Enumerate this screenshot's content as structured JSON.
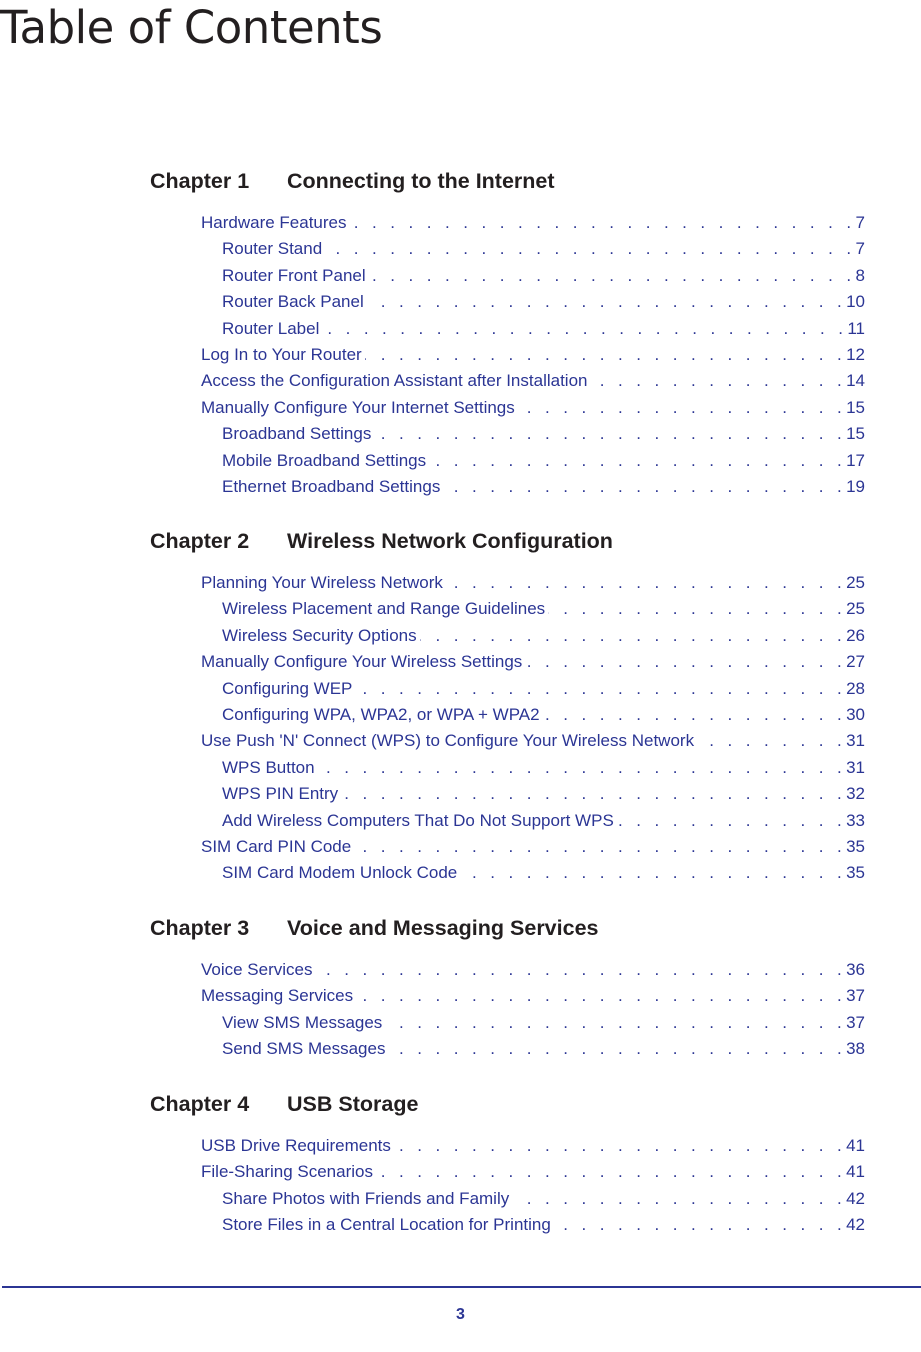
{
  "page": {
    "title": "Table of Contents",
    "footer_page_number": "3",
    "colors": {
      "heading": "#231f20",
      "entry_text": "#2b3594",
      "footer_rule": "#2b3594"
    }
  },
  "chapters": [
    {
      "label": "Chapter 1",
      "title": "Connecting to the Internet",
      "entries": [
        {
          "level": 1,
          "title": "Hardware Features",
          "page": "7"
        },
        {
          "level": 2,
          "title": "Router Stand",
          "page": "7"
        },
        {
          "level": 2,
          "title": "Router Front Panel",
          "page": "8"
        },
        {
          "level": 2,
          "title": "Router Back Panel",
          "page": "10"
        },
        {
          "level": 2,
          "title": "Router Label",
          "page": "11"
        },
        {
          "level": 1,
          "title": "Log In to Your Router",
          "page": "12"
        },
        {
          "level": 1,
          "title": "Access the Configuration Assistant after Installation",
          "page": "14"
        },
        {
          "level": 1,
          "title": "Manually Configure Your Internet Settings",
          "page": "15"
        },
        {
          "level": 2,
          "title": "Broadband Settings",
          "page": "15"
        },
        {
          "level": 2,
          "title": "Mobile Broadband Settings",
          "page": "17"
        },
        {
          "level": 2,
          "title": "Ethernet Broadband Settings",
          "page": "19"
        }
      ]
    },
    {
      "label": "Chapter 2",
      "title": "Wireless Network Configuration",
      "entries": [
        {
          "level": 1,
          "title": "Planning Your Wireless Network",
          "page": "25"
        },
        {
          "level": 2,
          "title": "Wireless Placement and Range Guidelines",
          "page": "25"
        },
        {
          "level": 2,
          "title": "Wireless Security Options",
          "page": "26"
        },
        {
          "level": 1,
          "title": "Manually Configure Your Wireless Settings",
          "page": "27"
        },
        {
          "level": 2,
          "title": "Configuring WEP",
          "page": "28"
        },
        {
          "level": 2,
          "title": "Configuring WPA, WPA2, or WPA + WPA2",
          "page": "30"
        },
        {
          "level": 1,
          "title": "Use Push 'N' Connect (WPS) to Configure Your Wireless Network",
          "page": "31"
        },
        {
          "level": 2,
          "title": "WPS Button",
          "page": "31"
        },
        {
          "level": 2,
          "title": "WPS PIN Entry",
          "page": "32"
        },
        {
          "level": 2,
          "title": "Add Wireless Computers That Do Not Support WPS",
          "page": "33"
        },
        {
          "level": 1,
          "title": "SIM Card PIN Code",
          "page": "35"
        },
        {
          "level": 2,
          "title": "SIM Card Modem Unlock Code",
          "page": "35"
        }
      ]
    },
    {
      "label": "Chapter 3",
      "title": "Voice and Messaging Services",
      "entries": [
        {
          "level": 1,
          "title": "Voice Services",
          "page": "36"
        },
        {
          "level": 1,
          "title": "Messaging Services",
          "page": "37"
        },
        {
          "level": 2,
          "title": "View SMS Messages",
          "page": "37"
        },
        {
          "level": 2,
          "title": "Send SMS Messages",
          "page": "38"
        }
      ]
    },
    {
      "label": "Chapter 4",
      "title": "USB Storage",
      "entries": [
        {
          "level": 1,
          "title": "USB Drive Requirements",
          "page": "41"
        },
        {
          "level": 1,
          "title": "File-Sharing Scenarios",
          "page": "41"
        },
        {
          "level": 2,
          "title": "Share Photos with Friends and Family",
          "page": "42"
        },
        {
          "level": 2,
          "title": "Store Files in a Central Location for Printing",
          "page": "42"
        }
      ]
    }
  ]
}
